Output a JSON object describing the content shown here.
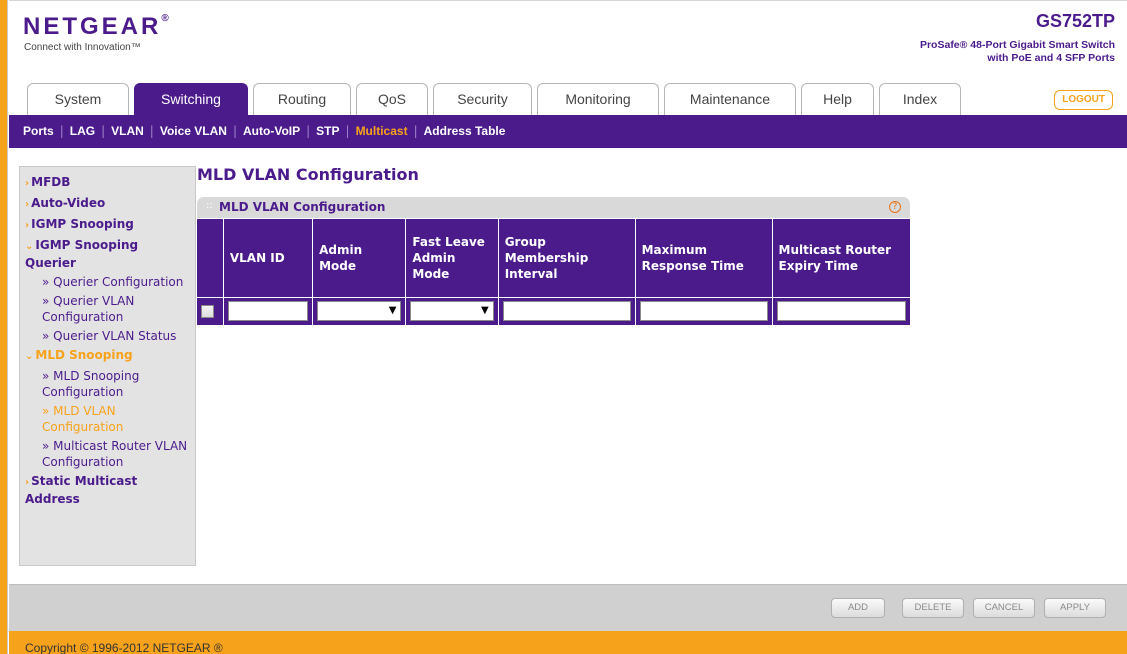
{
  "brand": {
    "logo": "NETGEAR",
    "logo_mark": "®",
    "tagline": "Connect with Innovation™",
    "model": "GS752TP",
    "model_desc_line1": "ProSafe® 48-Port Gigabit Smart Switch",
    "model_desc_line2": "with PoE and 4 SFP Ports"
  },
  "tabs": [
    {
      "label": "System"
    },
    {
      "label": "Switching"
    },
    {
      "label": "Routing"
    },
    {
      "label": "QoS"
    },
    {
      "label": "Security"
    },
    {
      "label": "Monitoring"
    },
    {
      "label": "Maintenance"
    },
    {
      "label": "Help"
    },
    {
      "label": "Index"
    }
  ],
  "active_tab": "Switching",
  "logout_label": "LOGOUT",
  "subnav": [
    {
      "label": "Ports"
    },
    {
      "label": "LAG"
    },
    {
      "label": "VLAN"
    },
    {
      "label": "Voice VLAN"
    },
    {
      "label": "Auto-VoIP"
    },
    {
      "label": "STP"
    },
    {
      "label": "Multicast"
    },
    {
      "label": "Address Table"
    }
  ],
  "active_subnav": "Multicast",
  "sidebar": {
    "mfdb": "MFDB",
    "auto_video": "Auto-Video",
    "igmp_snooping": "IGMP Snooping",
    "igmp_querier": "IGMP Snooping Querier",
    "querier_config": "» Querier Configuration",
    "querier_vlan_config": "» Querier VLAN Configuration",
    "querier_vlan_status": "» Querier VLAN Status",
    "mld_snooping": "MLD Snooping",
    "mld_snooping_config": "» MLD Snooping Configuration",
    "mld_vlan_config": "» MLD VLAN Configuration",
    "mcast_router_vlan": "» Multicast Router VLAN Configuration",
    "static_mcast": "Static Multicast Address"
  },
  "main": {
    "page_title": "MLD VLAN Configuration",
    "panel_title": "MLD VLAN Configuration",
    "help_icon": "?",
    "columns": {
      "vlan_id": "VLAN ID",
      "admin_mode": "Admin Mode",
      "fast_leave": "Fast Leave Admin Mode",
      "group_membership": "Group Membership Interval",
      "max_response": "Maximum Response Time",
      "mcast_router_expiry": "Multicast Router Expiry Time"
    },
    "row": {
      "vlan_id": "",
      "admin_mode": "",
      "fast_leave": "",
      "group_membership": "",
      "max_response": "",
      "mcast_router_expiry": ""
    }
  },
  "buttons": {
    "add": "ADD",
    "delete": "DELETE",
    "cancel": "CANCEL",
    "apply": "APPLY"
  },
  "footer": {
    "copyright": "Copyright © 1996-2012 NETGEAR ®"
  },
  "colors": {
    "brand_purple": "#4b1b8c",
    "accent_orange": "#f7a21b"
  }
}
